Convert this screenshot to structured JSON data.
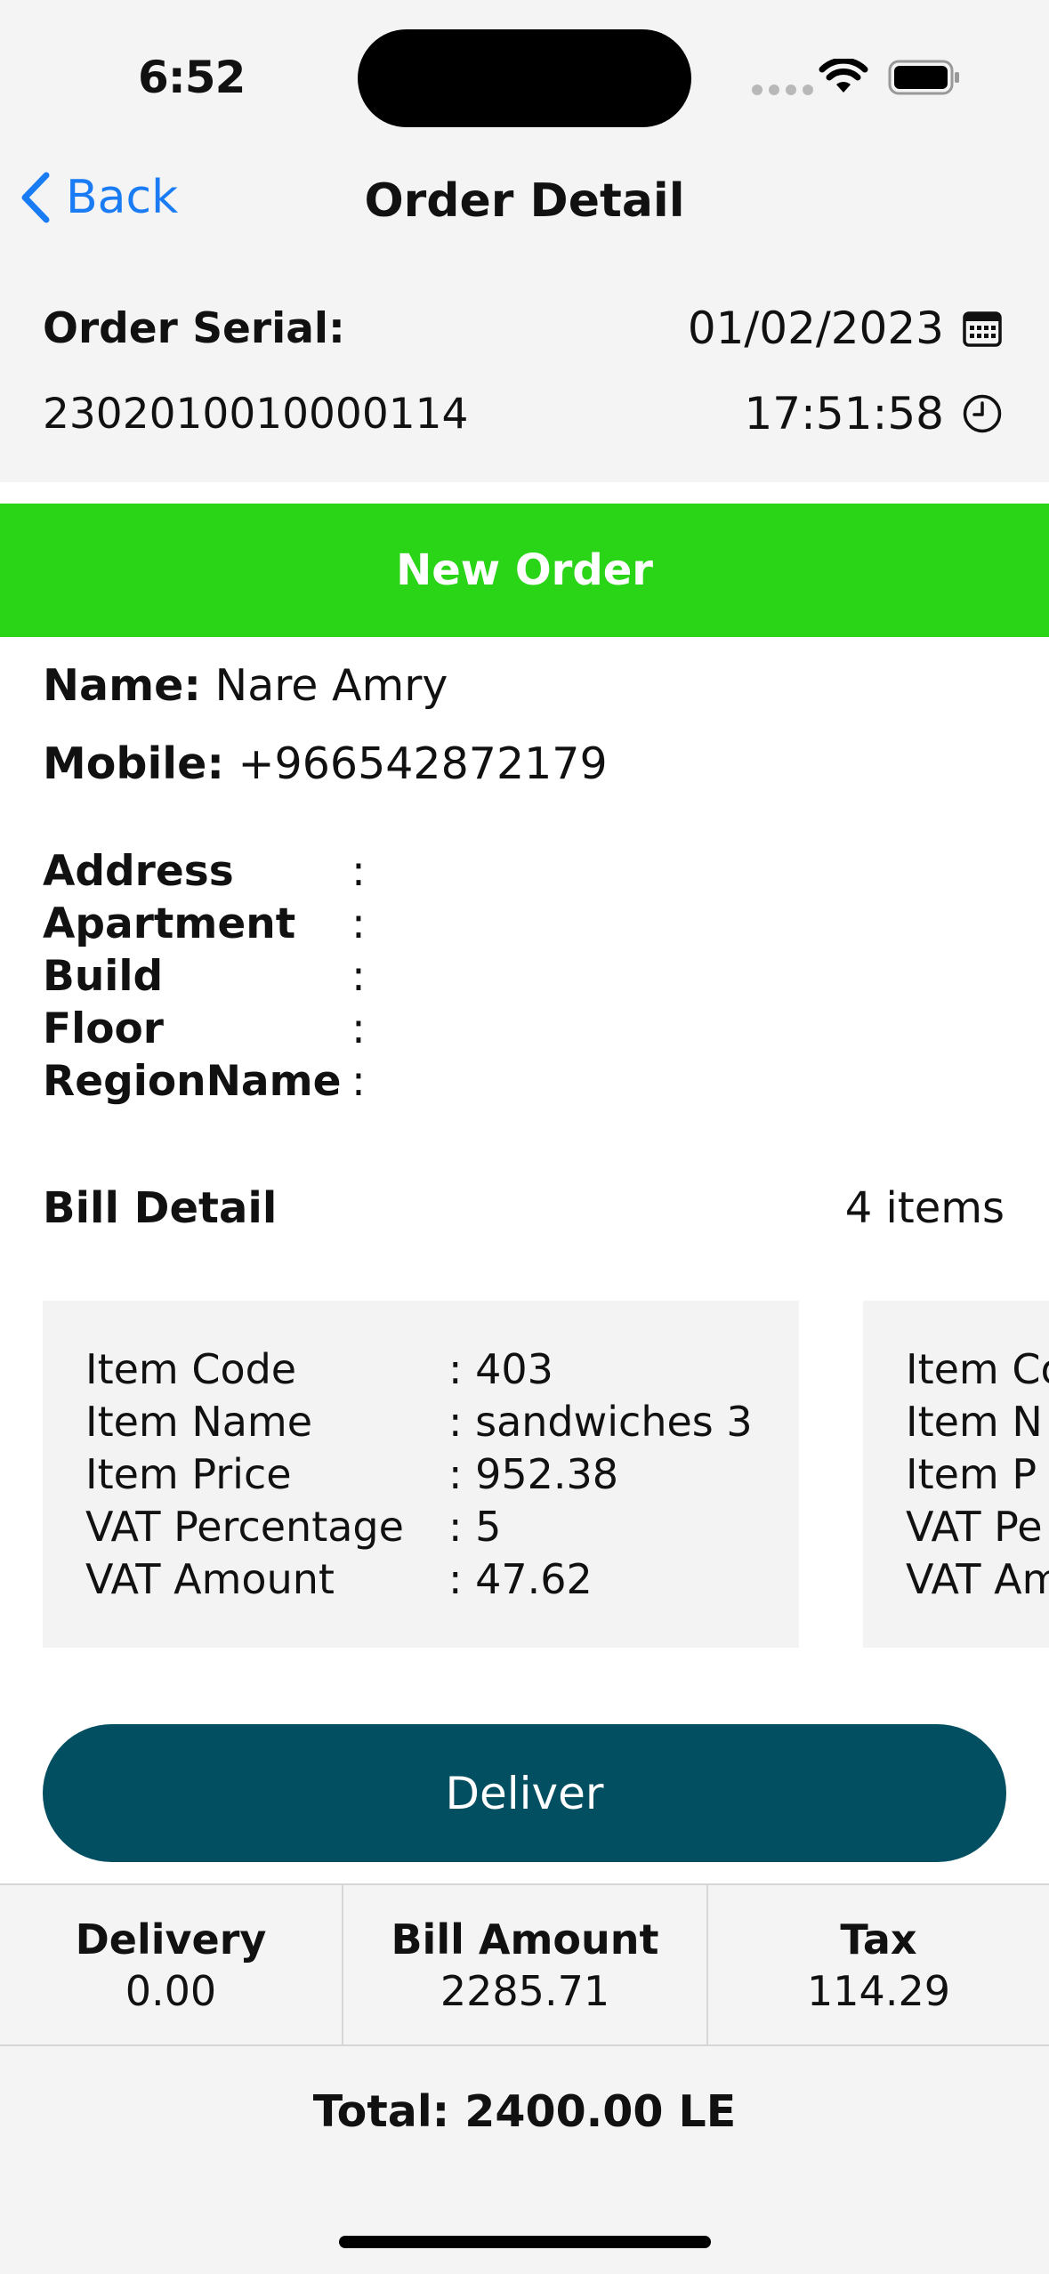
{
  "status_bar": {
    "time": "6:52"
  },
  "nav": {
    "back_label": "Back",
    "title": "Order Detail"
  },
  "order": {
    "serial_label": "Order Serial:",
    "serial_value": "2302010010000114",
    "date": "01/02/2023",
    "time": "17:51:58"
  },
  "status_banner": "New Order",
  "customer": {
    "name_label": "Name:",
    "name_value": "Nare Amry",
    "mobile_label": "Mobile:",
    "mobile_value": "+966542872179"
  },
  "address_fields": {
    "address": "Address",
    "apartment": "Apartment",
    "build": "Build",
    "floor": "Floor",
    "region": "RegionName",
    "colon": ":"
  },
  "bill": {
    "title": "Bill Detail",
    "count": "4 items",
    "items": [
      {
        "code_label": "Item Code",
        "code": ": 403",
        "name_label": "Item Name",
        "name": ": sandwiches 3",
        "price_label": "Item Price",
        "price": ": 952.38",
        "vat_pct_label": "VAT Percentage",
        "vat_pct": ": 5",
        "vat_amt_label": "VAT Amount",
        "vat_amt": ": 47.62"
      },
      {
        "code_label": "Item Co",
        "name_label": "Item N",
        "price_label": "Item P",
        "vat_pct_label": "VAT Pe",
        "vat_amt_label": "VAT Am"
      }
    ]
  },
  "deliver_button": "Deliver",
  "summary": {
    "delivery_label": "Delivery",
    "delivery_value": "0.00",
    "bill_label": "Bill Amount",
    "bill_value": "2285.71",
    "tax_label": "Tax",
    "tax_value": "114.29"
  },
  "total": "Total: 2400.00 LE",
  "colors": {
    "accent_blue": "#1a7cf5",
    "status_green": "#2ad417",
    "deliver_teal": "#034f62"
  },
  "icons": [
    "chevron-left-icon",
    "calendar-icon",
    "clock-icon",
    "wifi-icon",
    "battery-icon"
  ]
}
